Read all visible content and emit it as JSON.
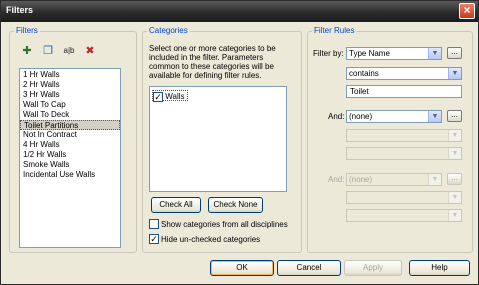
{
  "window": {
    "title": "Filters"
  },
  "filters": {
    "group_title": "Filters",
    "toolbar": [
      {
        "name": "new-filter-icon",
        "glyph": "✚"
      },
      {
        "name": "duplicate-filter-icon",
        "glyph": "❐"
      },
      {
        "name": "rename-filter-icon",
        "glyph": "a|b"
      },
      {
        "name": "delete-filter-icon",
        "glyph": "✖"
      }
    ],
    "items": [
      "1 Hr Walls",
      "2 Hr Walls",
      "3 Hr Walls",
      "Wall To Cap",
      "Wall To Deck",
      "Toilet Partitions",
      "Not In Contract",
      "4 Hr Walls",
      "1/2 Hr Walls",
      "Smoke Walls",
      "Incidental Use Walls"
    ],
    "selected_index": 5
  },
  "categories": {
    "group_title": "Categories",
    "description": "Select one or more categories to be included in the filter.  Parameters common to these categories will be available for defining filter rules.",
    "items": [
      {
        "label": "Walls",
        "checked": true
      }
    ],
    "check_all": "Check All",
    "check_none": "Check None",
    "show_all_disciplines": {
      "label": "Show categories from all disciplines",
      "checked": false
    },
    "hide_unchecked": {
      "label": "Hide un-checked categories",
      "checked": true
    }
  },
  "filter_rules": {
    "group_title": "Filter Rules",
    "filter_by_label": "Filter by:",
    "filter_by_value": "Type Name",
    "operator_value": "contains",
    "value_text": "Toilet",
    "and1_label": "And:",
    "and1_value": "(none)",
    "and2_label": "And:",
    "and2_value": "(none)",
    "ellipsis": "..."
  },
  "buttons": {
    "ok": "OK",
    "cancel": "Cancel",
    "apply": "Apply",
    "help": "Help"
  }
}
